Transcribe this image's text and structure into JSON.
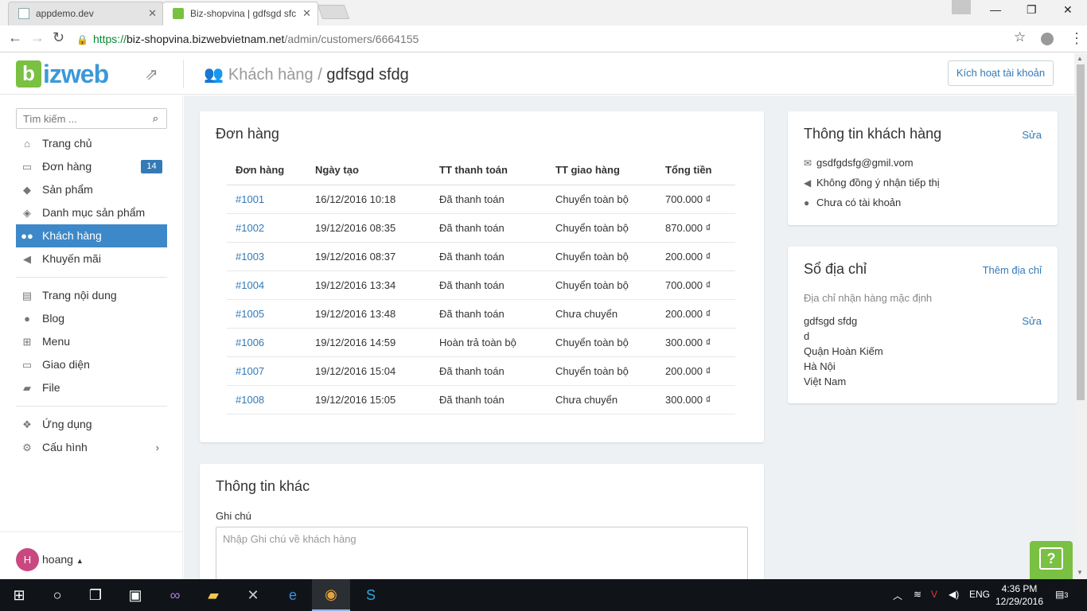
{
  "browser": {
    "tabs": [
      {
        "title": "appdemo.dev",
        "active": false
      },
      {
        "title": "Biz-shopvina | gdfsgd sfc",
        "active": true
      }
    ],
    "url": {
      "scheme": "https://",
      "host": "biz-shopvina.bizwebvietnam.net",
      "path": "/admin/customers/6664155"
    }
  },
  "header": {
    "logo": "bizweb",
    "breadcrumb_parent": "Khách hàng",
    "breadcrumb_sep": "/",
    "breadcrumb_current": "gdfsgd sfdg",
    "activate_label": "Kích hoạt tài khoản"
  },
  "sidebar": {
    "search_placeholder": "Tìm kiếm ...",
    "items": [
      {
        "label": "Trang chủ",
        "icon": "home-icon"
      },
      {
        "label": "Đơn hàng",
        "icon": "credit-card-icon",
        "badge": "14"
      },
      {
        "label": "Sản phẩm",
        "icon": "tag-icon"
      },
      {
        "label": "Danh mục sản phẩm",
        "icon": "tags-icon"
      },
      {
        "label": "Khách hàng",
        "icon": "users-icon",
        "active": true
      },
      {
        "label": "Khuyến mãi",
        "icon": "megaphone-icon"
      },
      {
        "label": "Trang nội dung",
        "icon": "file-text-icon"
      },
      {
        "label": "Blog",
        "icon": "comment-icon"
      },
      {
        "label": "Menu",
        "icon": "sitemap-icon"
      },
      {
        "label": "Giao diện",
        "icon": "desktop-icon"
      },
      {
        "label": "File",
        "icon": "folder-icon"
      },
      {
        "label": "Ứng dụng",
        "icon": "cubes-icon"
      },
      {
        "label": "Cấu hình",
        "icon": "cogs-icon"
      }
    ],
    "user": {
      "initial": "H",
      "name": "hoang"
    }
  },
  "orders": {
    "title": "Đơn hàng",
    "columns": [
      "Đơn hàng",
      "Ngày tạo",
      "TT thanh toán",
      "TT giao hàng",
      "Tổng tiền"
    ],
    "rows": [
      [
        "#1001",
        "16/12/2016 10:18",
        "Đã thanh toán",
        "Chuyển toàn bộ",
        "700.000 ₫"
      ],
      [
        "#1002",
        "19/12/2016 08:35",
        "Đã thanh toán",
        "Chuyển toàn bộ",
        "870.000 ₫"
      ],
      [
        "#1003",
        "19/12/2016 08:37",
        "Đã thanh toán",
        "Chuyển toàn bộ",
        "200.000 ₫"
      ],
      [
        "#1004",
        "19/12/2016 13:34",
        "Đã thanh toán",
        "Chuyển toàn bộ",
        "700.000 ₫"
      ],
      [
        "#1005",
        "19/12/2016 13:48",
        "Đã thanh toán",
        "Chưa chuyển",
        "200.000 ₫"
      ],
      [
        "#1006",
        "19/12/2016 14:59",
        "Hoàn trả toàn bộ",
        "Chuyển toàn bộ",
        "300.000 ₫"
      ],
      [
        "#1007",
        "19/12/2016 15:04",
        "Đã thanh toán",
        "Chuyển toàn bộ",
        "200.000 ₫"
      ],
      [
        "#1008",
        "19/12/2016 15:05",
        "Đã thanh toán",
        "Chưa chuyển",
        "300.000 ₫"
      ]
    ]
  },
  "customer_info": {
    "title": "Thông tin khách hàng",
    "edit_label": "Sửa",
    "email": "gsdfgdsfg@gmil.vom",
    "marketing": "Không đồng ý nhận tiếp thị",
    "account": "Chưa có tài khoản"
  },
  "address_book": {
    "title": "Sổ địa chỉ",
    "add_label": "Thêm địa chỉ",
    "default_label": "Địa chỉ nhận hàng mặc định",
    "edit_label": "Sửa",
    "lines": [
      "gdfsgd sfdg",
      "d",
      "Quận Hoàn Kiếm",
      "Hà Nội",
      "Việt Nam"
    ]
  },
  "other_info": {
    "title": "Thông tin khác",
    "note_label": "Ghi chú",
    "note_placeholder": "Nhập Ghi chú về khách hàng"
  },
  "taskbar": {
    "lang": "ENG",
    "time": "4:36 PM",
    "date": "12/29/2016",
    "notifications": "3"
  },
  "colors": {
    "brand_green": "#7ac043",
    "brand_blue": "#3b99d9",
    "active_nav": "#3d88c8",
    "link": "#337ab7"
  }
}
